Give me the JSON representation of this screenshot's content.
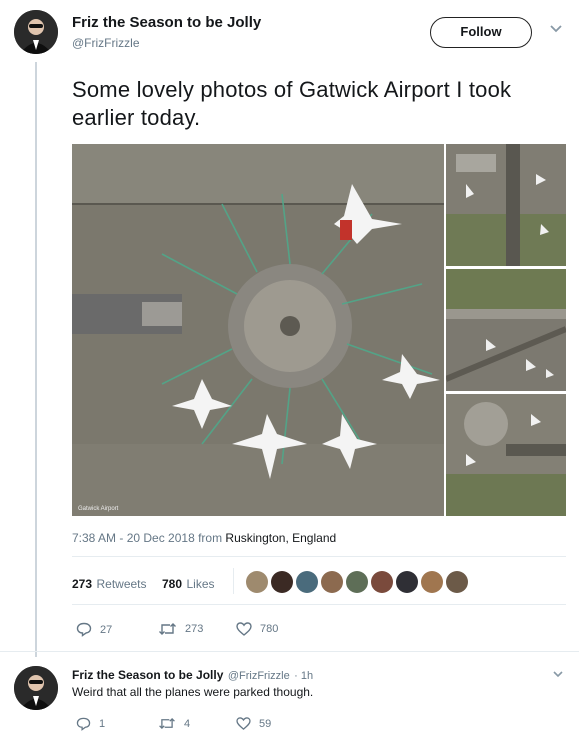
{
  "tweet": {
    "author_name": "Friz the Season to be Jolly",
    "author_handle": "@FrizFrizzle",
    "follow_label": "Follow",
    "text": "Some lovely photos of Gatwick Airport I took earlier today.",
    "photo_watermark": "Gatwick Airport",
    "timestamp": "7:38 AM - 20 Dec 2018 from",
    "location": "Ruskington, England",
    "retweets_count": "273",
    "retweets_label": "Retweets",
    "likes_count": "780",
    "likes_label": "Likes",
    "actions": {
      "replies": "27",
      "retweets": "273",
      "likes": "780"
    }
  },
  "reply": {
    "author_name": "Friz the Season to be Jolly",
    "author_handle": "@FrizFrizzle",
    "time": "· 1h",
    "text": "Weird that all the planes were parked though.",
    "actions": {
      "replies": "1",
      "retweets": "4",
      "likes": "59"
    }
  },
  "icons": {
    "chevron": "chevron-down-icon",
    "reply": "reply-icon",
    "retweet": "retweet-icon",
    "like": "heart-icon"
  },
  "colors": {
    "accent": "#1da1f2",
    "muted": "#657786",
    "text": "#14171a"
  }
}
